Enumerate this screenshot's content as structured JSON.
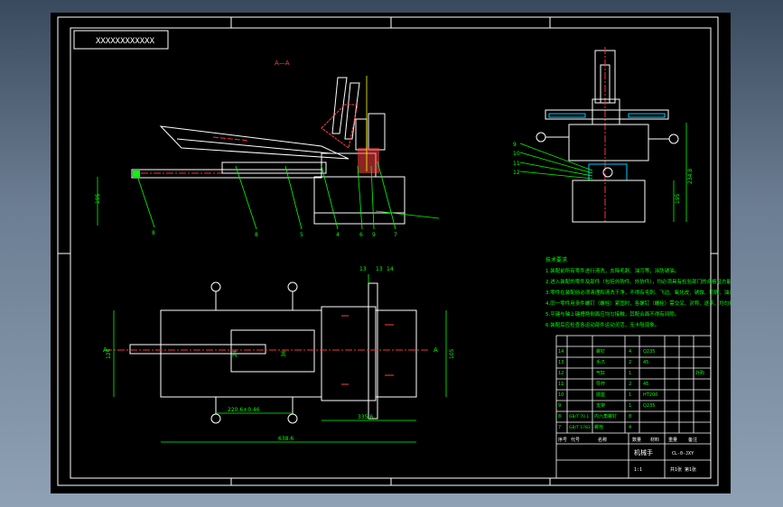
{
  "title_box": {
    "text": "XXXXXXXXXXXX"
  },
  "section_label": {
    "text": "A—A"
  },
  "colors": {
    "background": "#000000",
    "frame": "#ffffff",
    "part": "#ffffff",
    "hatch": "#ff4040",
    "dimension": "#00ff00",
    "center_line": "#ff3030",
    "accent_cyan": "#00c8ff",
    "accent_yellow": "#ffff00"
  },
  "view_front": {
    "dims": {
      "height_left": "195"
    },
    "leaders": [
      "8",
      "8",
      "5",
      "4",
      "6",
      "9",
      "7"
    ]
  },
  "view_side": {
    "leaders": [
      "9",
      "10",
      "11",
      "12"
    ],
    "dims": {
      "height_total": "234.8",
      "base_height": "195"
    }
  },
  "view_top": {
    "markers": [
      "A",
      "A"
    ],
    "dims": {
      "left_width": "124",
      "right_width": "105",
      "inner_width": "24",
      "center_width": "36",
      "span_small": "220.6±0.46",
      "span_mid": "335.6",
      "span_total": "638.6"
    },
    "balloons": [
      "13",
      "13",
      "14"
    ]
  },
  "notes": {
    "heading": "技术要求",
    "lines": [
      "1.装配前所有零件进行清洗，去除毛刺、油污等，涂防锈油。",
      "2.进入装配的零件及部件（包括外购件、外协件），均必须具有检验部门的合格证方能进行装配。",
      "3.零件在装配前必须清理和清洗干净，不得有毛刺、飞边、氧化皮、锈蚀、切屑、油污、着色剂和灰尘等。",
      "4.同一零件用多件螺钉（螺栓）紧固时，各螺钉（螺栓）需交叉、对称、逐步、均匀拧紧。",
      "5.平键与轴上键槽两侧面应均匀接触，其配合面不得有间隙。",
      "6.装配后应检查各运动部件运动灵活，无卡阻现象。"
    ]
  },
  "title_block": {
    "drawing_name": "机械手",
    "drawing_no": "CL-0-JXY",
    "scale": "1:1",
    "sheet": "共1张 第1张",
    "header_cells": [
      "序号",
      "代号",
      "名称",
      "数量",
      "材料",
      "重量",
      "备注"
    ],
    "rows": [
      [
        "14",
        "",
        "螺钉",
        "4",
        "Q235",
        "",
        ""
      ],
      [
        "13",
        "",
        "手爪",
        "2",
        "45",
        "",
        ""
      ],
      [
        "12",
        "",
        "气缸",
        "1",
        "",
        "",
        "外购"
      ],
      [
        "11",
        "",
        "导杆",
        "2",
        "45",
        "",
        ""
      ],
      [
        "10",
        "",
        "底座",
        "1",
        "HT200",
        "",
        ""
      ],
      [
        "9",
        "",
        "支架",
        "1",
        "Q235",
        "",
        ""
      ],
      [
        "8",
        "GB/T 70.1",
        "内六角螺钉",
        "8",
        "",
        "",
        ""
      ],
      [
        "7",
        "GB/T 5783",
        "螺栓",
        "4",
        "",
        "",
        ""
      ]
    ]
  }
}
